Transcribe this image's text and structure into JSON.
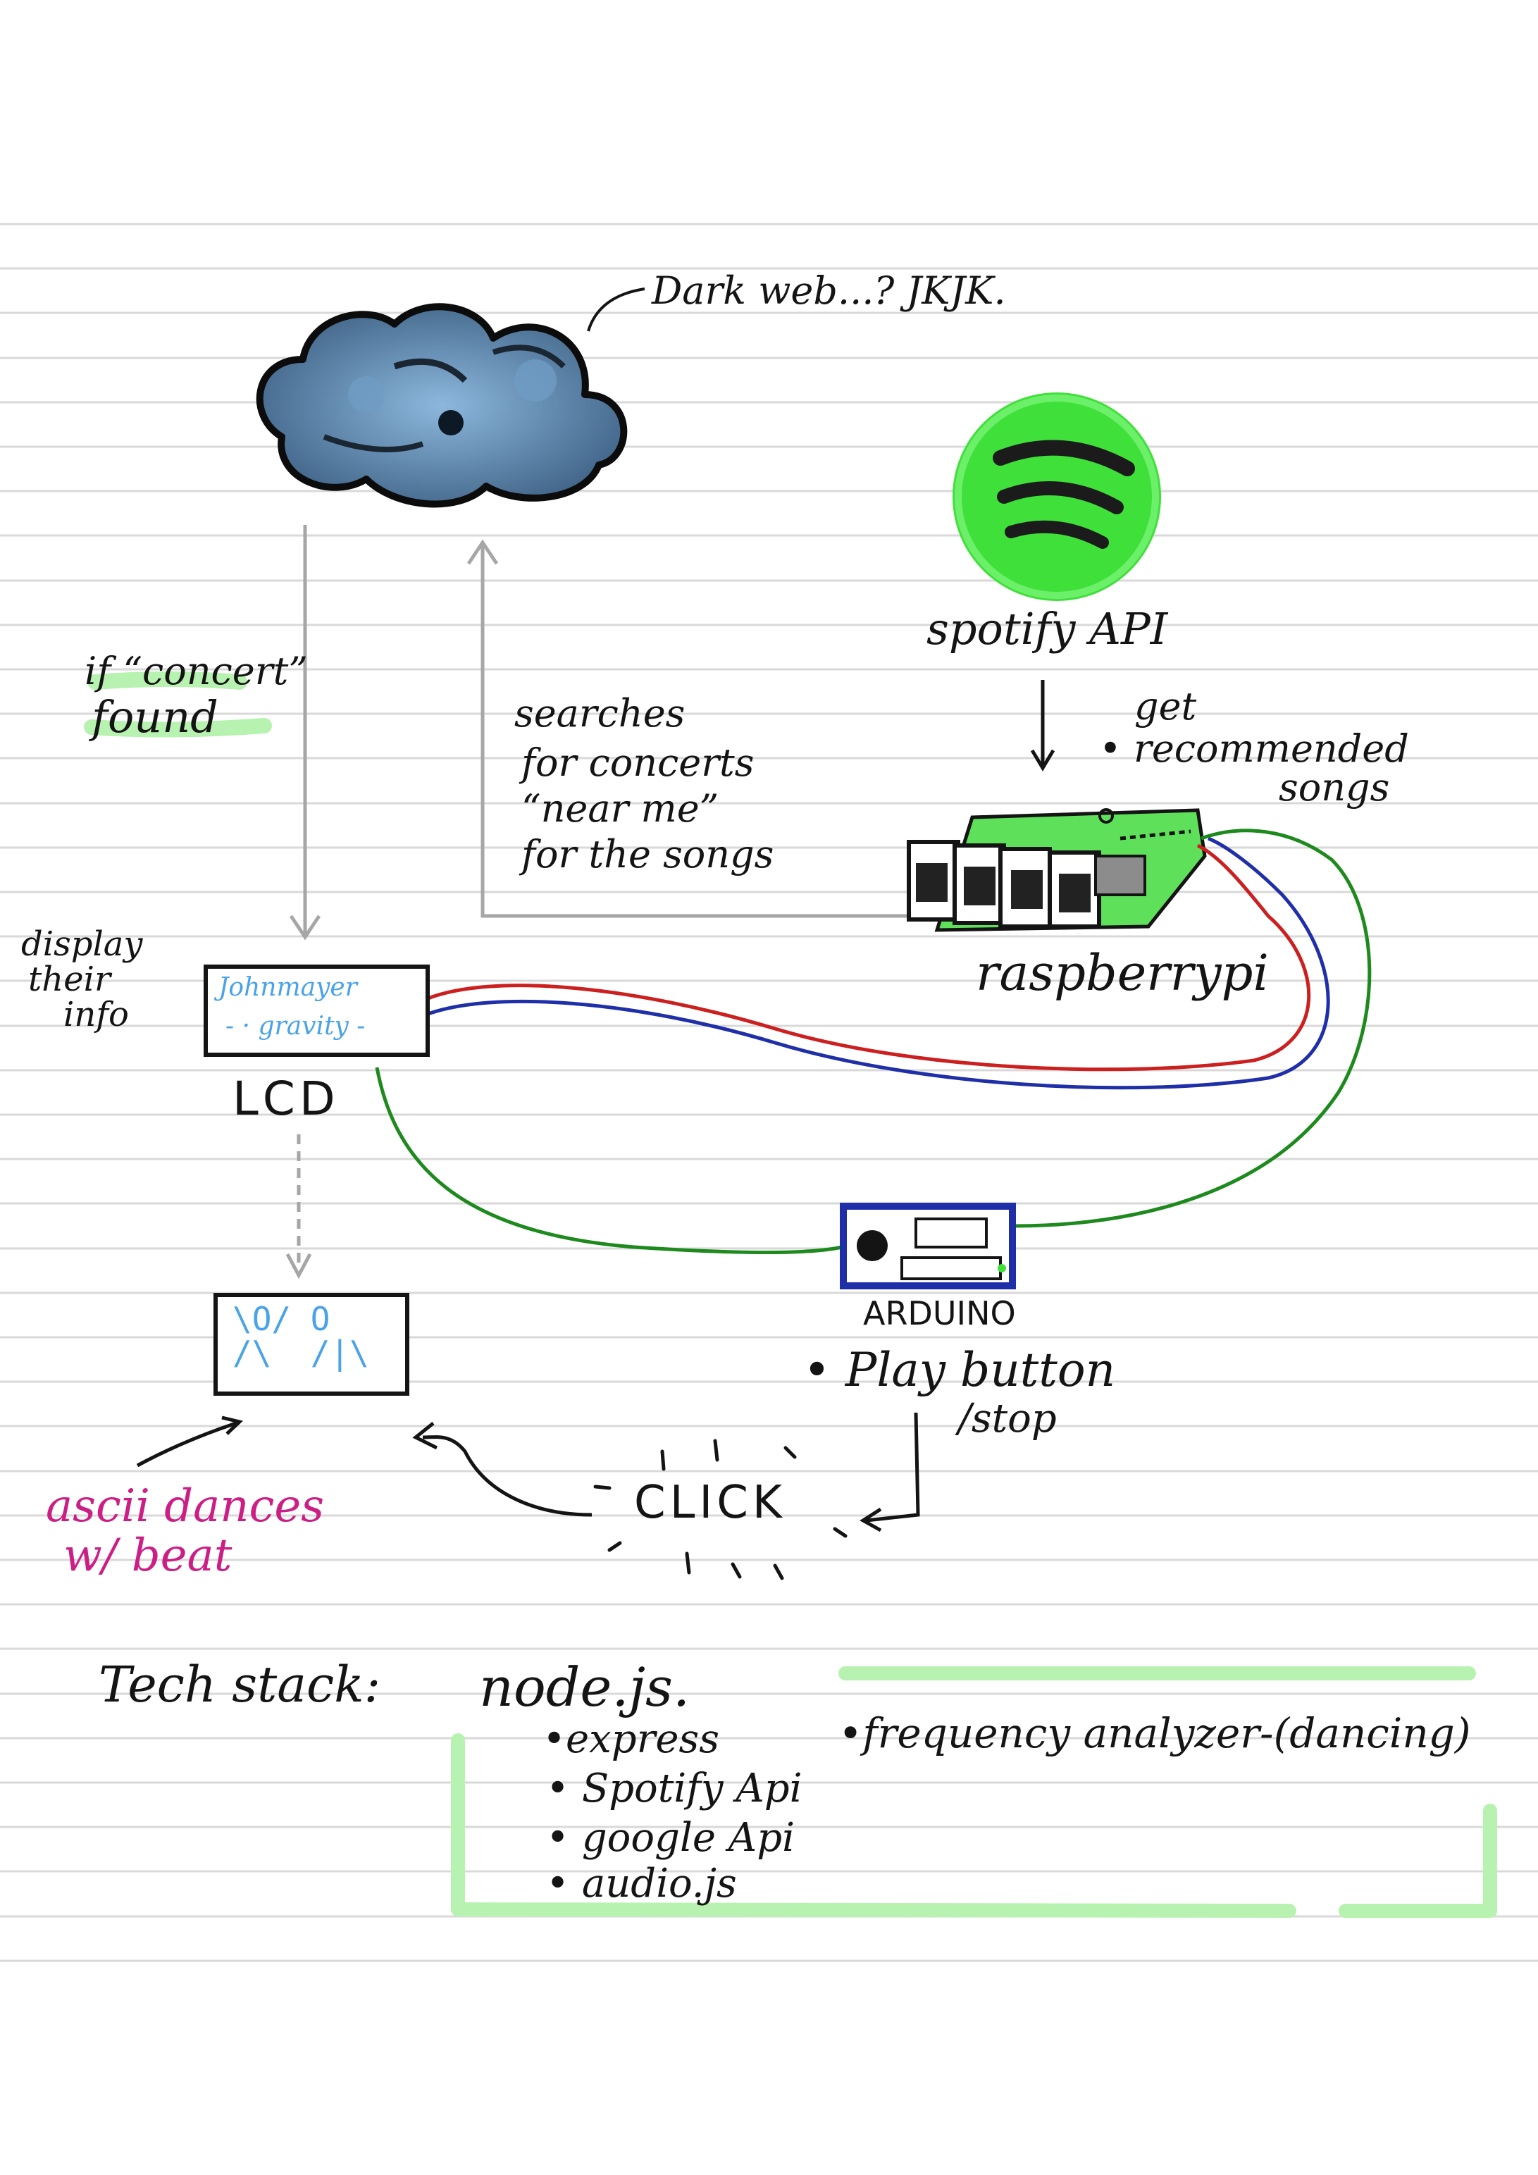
{
  "notes": {
    "cloud_caption": "Dark web...? JKJK.",
    "spotify_caption": "spotify API",
    "get_recommended": [
      "get",
      "• recommended",
      "songs"
    ],
    "concert_found": [
      "if “concert”",
      "found"
    ],
    "searches": [
      "searches",
      "for concerts",
      "“near me”",
      "for the songs"
    ],
    "raspberry_label": "raspberrypi",
    "display_info": [
      "display",
      "their",
      "info"
    ],
    "lcd_screen": [
      "Johnmayer",
      "- · gravity -"
    ],
    "lcd_label": "LCD",
    "ascii_figures": "\\O/ O\n/\\  /|\\",
    "arduino_label": "ARDUINO",
    "play_button": [
      "• Play button",
      "/stop"
    ],
    "click": "CLICK",
    "ascii_dances": [
      "ascii dances",
      "w/ beat"
    ],
    "tech_stack_label": "Tech stack:",
    "tech_stack_main": "node.js.",
    "tech_stack_items": [
      "•express",
      "• Spotify Api",
      "• google Api",
      "• audio.js"
    ],
    "frequency_analyzer": "•frequency analyzer-(dancing)"
  },
  "colors": {
    "ink": "#141414",
    "rule_lines": "#d9d9d9",
    "highlight_green": "#a8f0a0",
    "spotify_green": "#3fe03a",
    "cloud_blue": "#4f7da6",
    "wire_red": "#cc1f1f",
    "wire_blue": "#1f2fa8",
    "wire_green": "#1e8a1e",
    "pi_green": "#5fe05a",
    "lcd_text_blue": "#4aa3e8",
    "magenta": "#cc1f86",
    "arrow_gray": "#a6a6a6"
  },
  "icons": [
    "cloud-icon",
    "spotify-logo-icon",
    "raspberry-pi-board-icon",
    "arduino-board-icon",
    "lcd-display-icon",
    "ascii-dance-screen-icon"
  ]
}
